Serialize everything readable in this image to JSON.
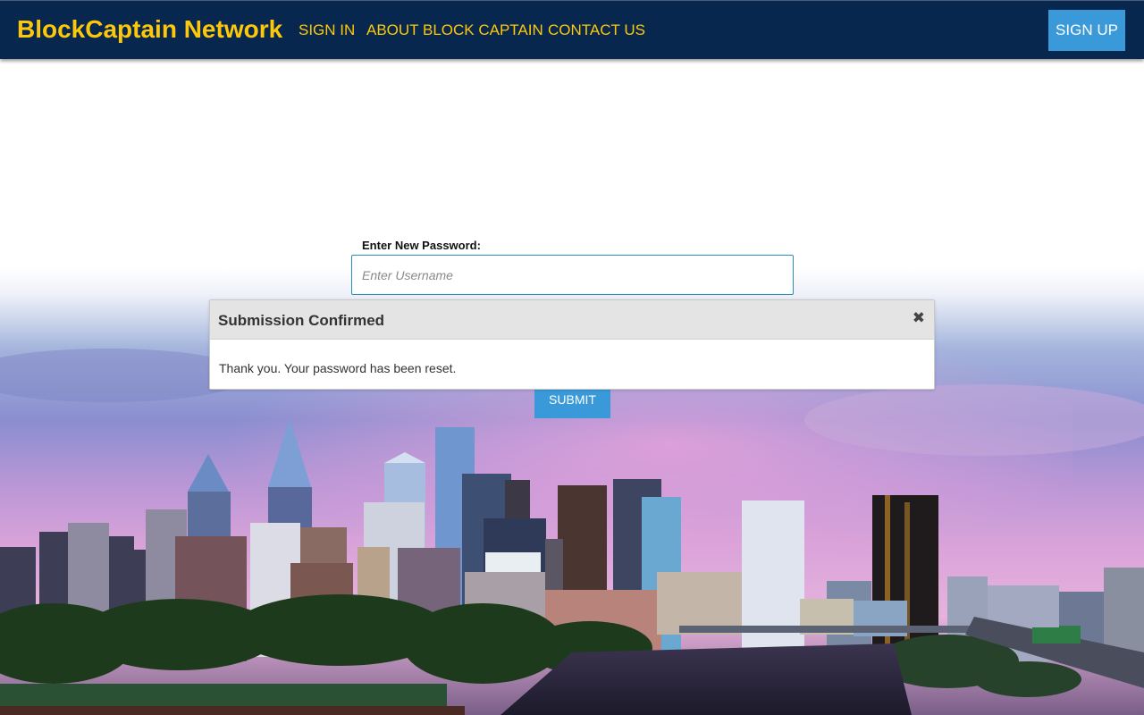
{
  "navbar": {
    "brand": "BlockCaptain Network",
    "links": [
      {
        "label": "SIGN IN"
      },
      {
        "label": "ABOUT BLOCK CAPTAIN"
      },
      {
        "label": "CONTACT US"
      }
    ],
    "signup_label": "SIGN UP",
    "background_color": "#07274f",
    "accent_color": "#fec80a",
    "button_color": "#3a9ad9"
  },
  "form": {
    "label": "Enter New Password:",
    "input_placeholder": "Enter Username",
    "input_value": "",
    "submit_label": "SUBMIT"
  },
  "modal": {
    "title": "Submission Confirmed",
    "close_icon": "close-x-icon",
    "message": "Thank you. Your password has been reset."
  }
}
